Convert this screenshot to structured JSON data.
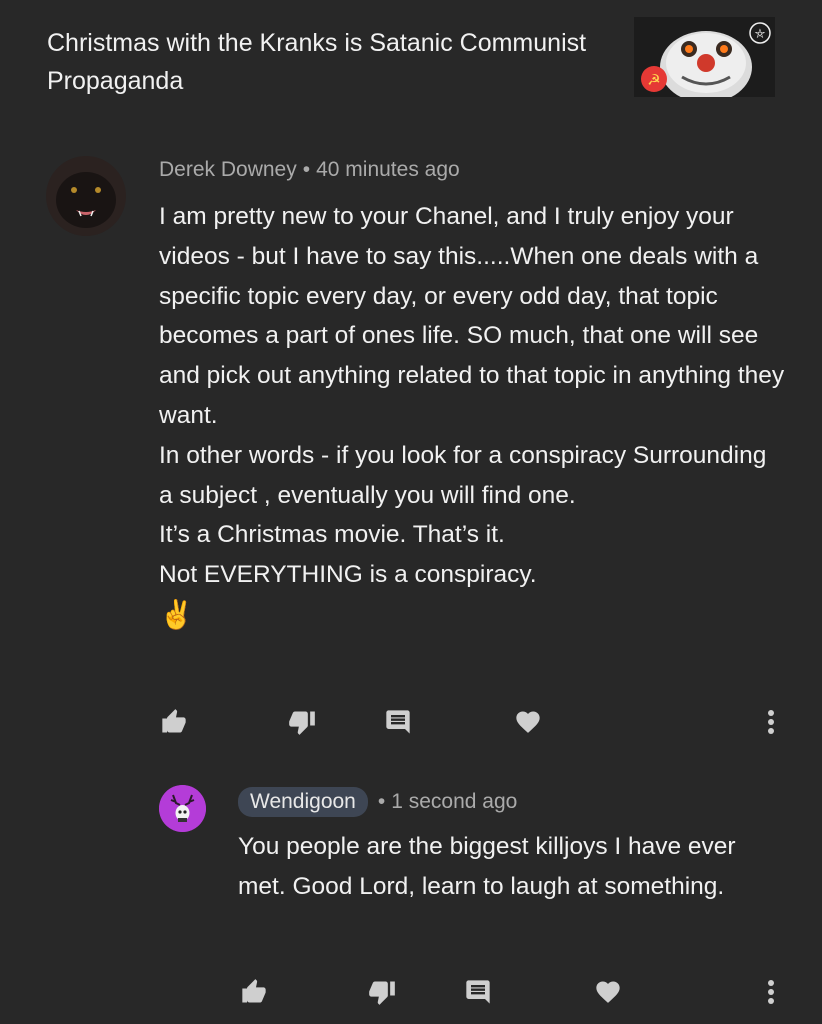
{
  "video": {
    "title": "Christmas with the Kranks is Satanic Communist Propaganda"
  },
  "comments": [
    {
      "author": "Derek Downey",
      "time": "40 minutes ago",
      "lines": [
        "I am pretty new to your Chanel, and I truly enjoy your videos - but I have to say this.....When one deals with a specific topic every day, or every odd day, that topic becomes a part of ones life. SO much, that one will see and pick out anything related to that topic in anything they want.",
        "In other words - if you look for a conspiracy Surrounding a subject , eventually you will find one.",
        "It’s a Christmas movie. That’s it.",
        "Not EVERYTHING is a conspiracy.",
        "✌️"
      ]
    },
    {
      "author": "Wendigoon",
      "time": "1 second ago",
      "lines": [
        "You people are the biggest killjoys I have ever met. Good Lord, learn to laugh at something."
      ]
    }
  ],
  "icons": {
    "like": "thumbs-up-icon",
    "dislike": "thumbs-down-icon",
    "reply": "reply-icon",
    "heart": "heart-icon",
    "more": "more-vertical-icon"
  },
  "colors": {
    "background": "#282828",
    "meta_text": "#aaaaaa",
    "creator_chip": "#3e4654",
    "reply_avatar": "#b43cd8"
  }
}
